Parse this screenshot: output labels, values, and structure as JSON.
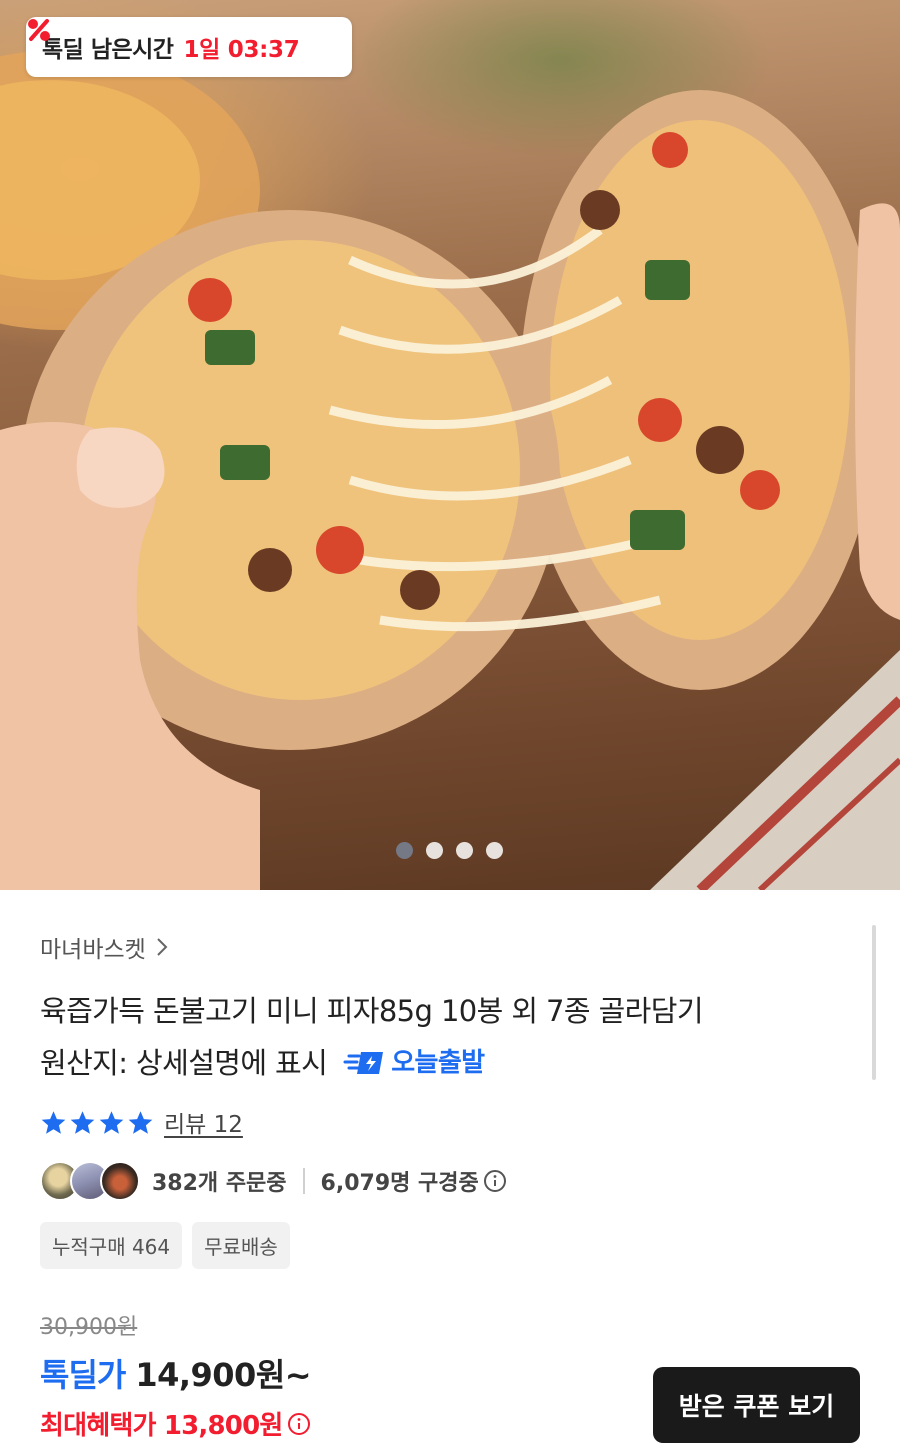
{
  "hero": {
    "timer_label": "톡딜 남은시간",
    "timer_value": "1일 03:37",
    "carousel_total": 4,
    "carousel_active": 1
  },
  "product": {
    "seller": "마녀바스켓",
    "title_line1": "육즙가득 돈불고기 미니 피자85g 10봉 외 7종 골라담기",
    "title_line2": "원산지: 상세설명에 표시",
    "ship_badge": "오늘출발",
    "rating_stars": 4,
    "review_label": "리뷰 12",
    "orders": "382개 주문중",
    "viewers": "6,079명 구경중",
    "tags": [
      "누적구매 464",
      "무료배송"
    ]
  },
  "price": {
    "original": "30,900원",
    "deal_label": "톡딜가",
    "deal_price": "14,900원~",
    "max_benefit": "최대혜택가 13,800원"
  },
  "actions": {
    "coupon_button": "받은 쿠폰 보기"
  },
  "colors": {
    "accent_blue": "#1e6cf0",
    "accent_red": "#f21d2f",
    "button_dark": "#1a1a1a"
  }
}
